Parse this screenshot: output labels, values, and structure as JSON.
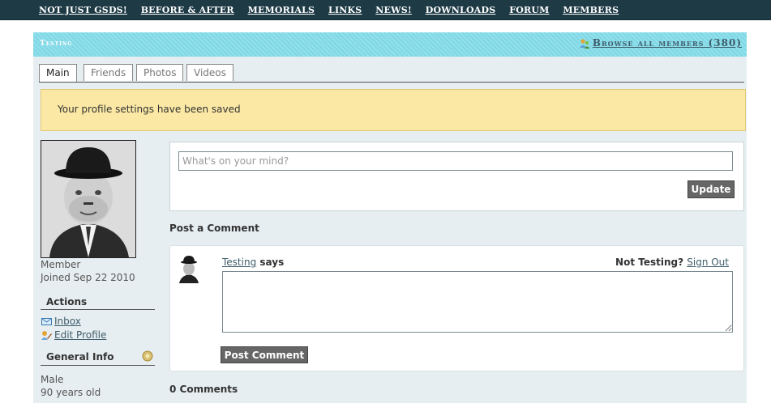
{
  "nav": {
    "items": [
      "NOT JUST GSDS!",
      "BEFORE & AFTER",
      "MEMORIALS",
      "LINKS",
      "NEWS!",
      "DOWNLOADS",
      "FORUM",
      "MEMBERS"
    ]
  },
  "header": {
    "title": "Testing",
    "browse_label": "Browse all members (380)"
  },
  "tabs": [
    "Main",
    "Friends",
    "Photos",
    "Videos"
  ],
  "notice": "Your profile settings have been saved",
  "profile": {
    "role": "Member",
    "joined": "Joined Sep 22 2010",
    "actions_heading": "Actions",
    "inbox_label": "Inbox",
    "edit_profile_label": "Edit Profile",
    "general_heading": "General Info",
    "gender": "Male",
    "age": "90 years old"
  },
  "status": {
    "placeholder": "What's on your mind?",
    "update_label": "Update"
  },
  "comment": {
    "heading": "Post a Comment",
    "author": "Testing",
    "says": "says",
    "not_you": "Not Testing?",
    "sign_out": "Sign Out",
    "post_label": "Post Comment",
    "count_label": "0 Comments"
  },
  "colors": {
    "nav_bg": "#1d3a45",
    "header_bg": "#7dd8e6",
    "content_bg": "#e7eef1",
    "notice_bg": "#fbe8a4",
    "link": "#3f5d6b",
    "button_bg": "#666666"
  },
  "icons": [
    "members-icon",
    "inbox-icon",
    "edit-profile-icon",
    "settings-gear-icon"
  ]
}
